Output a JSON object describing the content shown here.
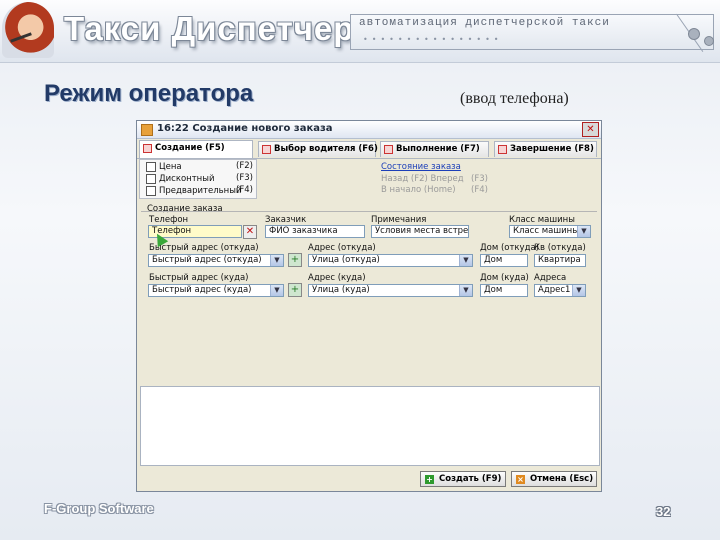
{
  "header": {
    "brand": "Такси Диспетчер",
    "tagline": "автоматизация диспетчерской такси"
  },
  "slide": {
    "title": "Режим оператора",
    "subtitle": "(ввод телефона)",
    "footer_left": "F-Group Software",
    "page_number": "32"
  },
  "window": {
    "title": "16:22 Создание нового заказа",
    "tabs": [
      {
        "label": "Создание (F5)"
      },
      {
        "label": "Выбор водителя (F6)"
      },
      {
        "label": "Выполнение (F7)"
      },
      {
        "label": "Завершение (F8)"
      }
    ],
    "checkboxes": [
      {
        "label": "Цена",
        "hotkey": "(F2)"
      },
      {
        "label": "Дисконтный",
        "hotkey": "(F3)"
      },
      {
        "label": "Предварительный",
        "hotkey": "(F4)"
      }
    ],
    "status_link": "Состояние заказа",
    "status_line1": "Назад (F2)   Вперед",
    "status_line1_key": "(F3)",
    "status_line2": "В начало (Home)",
    "status_line2_key": "(F4)",
    "group_title": "Создание заказа",
    "labels": {
      "phone": "Телефон",
      "customer": "Заказчик",
      "note": "Примечания",
      "car_class": "Класс машины",
      "fast_from": "Быстрый адрес (откуда)",
      "addr_from": "Адрес (откуда)",
      "house_from": "Дом (откуда)",
      "apt_from": "Кв (откуда)",
      "fast_to": "Быстрый адрес (куда)",
      "addr_to": "Адрес (куда)",
      "house_to": "Дом (куда)",
      "addr2": "Адреса"
    },
    "fields": {
      "phone": "Телефон",
      "customer": "ФИО заказчика",
      "note": "Условия места встречи",
      "car_class": "Класс машины",
      "fast_from": "Быстрый адрес (откуда)",
      "addr_from": "Улица (откуда)",
      "house_from": "Дом",
      "apt_from": "Квартира",
      "fast_to": "Быстрый адрес (куда)",
      "addr_to": "Улица (куда)",
      "house_to": "Дом",
      "addr2": "Адрес1"
    },
    "buttons": {
      "create": "Создать (F9)",
      "cancel": "Отмена (Esc)"
    }
  },
  "colors": {
    "title": "#223a67",
    "link": "#1c3fb8",
    "create_icon": "#2e9a2e",
    "cancel_icon": "#e08a20"
  }
}
